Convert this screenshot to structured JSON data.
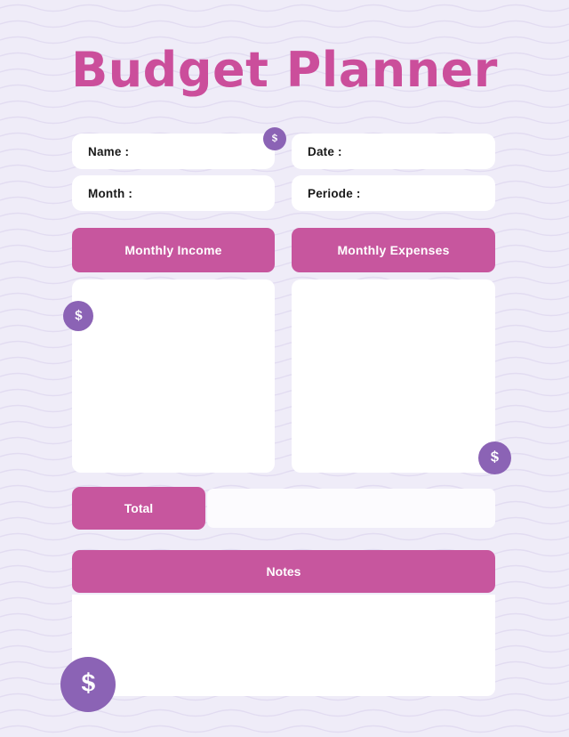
{
  "page": {
    "title": "Budget Planner",
    "background_color": "#EFECF8",
    "accent_pink": "#C7569E",
    "title_pink": "#CB4E9B",
    "coin_purple": "#8B63B5"
  },
  "fields": [
    {
      "id": "name",
      "label": "Name :",
      "value": "",
      "placeholder": ""
    },
    {
      "id": "date",
      "label": "Date :",
      "value": "",
      "placeholder": ""
    },
    {
      "id": "month",
      "label": "Month :",
      "value": "",
      "placeholder": ""
    },
    {
      "id": "period",
      "label": "Periode :",
      "value": "",
      "placeholder": ""
    }
  ],
  "sections": {
    "income_header": "Monthly Income",
    "expenses_header": "Monthly Expenses",
    "income_entries": "",
    "expenses_entries": "",
    "total_label": "Total",
    "total_value": "",
    "notes_label": "Notes",
    "notes_value": ""
  },
  "icons": {
    "coin_small": "dollar-coin-icon",
    "coin_medium": "dollar-coin-icon",
    "coin_large": "dollar-coin-icon",
    "coin_xlarge": "dollar-coin-icon"
  }
}
